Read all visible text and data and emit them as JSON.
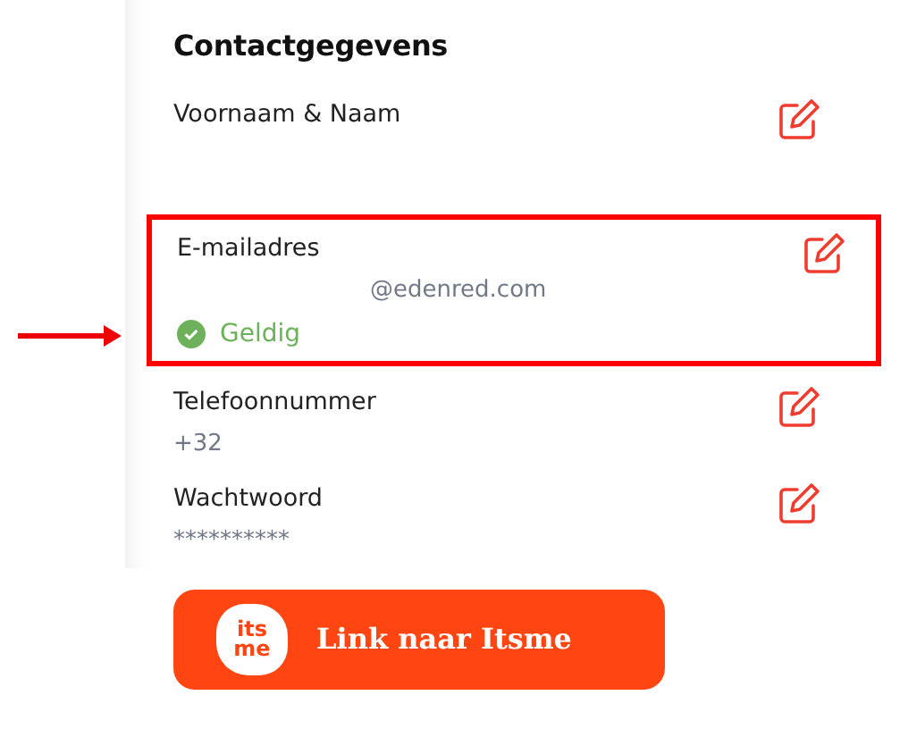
{
  "section": {
    "title": "Contactgegevens"
  },
  "fields": [
    {
      "label": "Voornaam & Naam",
      "editable": true,
      "highlighted": false
    },
    {
      "label": "E-mailadres",
      "value": "@edenred.com",
      "value_indent": true,
      "editable": true,
      "highlighted": true,
      "status": {
        "text": "Geldig",
        "valid": true
      }
    },
    {
      "label": "Telefoonnummer",
      "value": "+32",
      "editable": true,
      "highlighted": false
    },
    {
      "label": "Wachtwoord",
      "value": "**********",
      "editable": true,
      "highlighted": false
    }
  ],
  "itsme_button": {
    "logo_top": "its",
    "logo_bottom": "me",
    "label": "Link naar Itsme"
  }
}
